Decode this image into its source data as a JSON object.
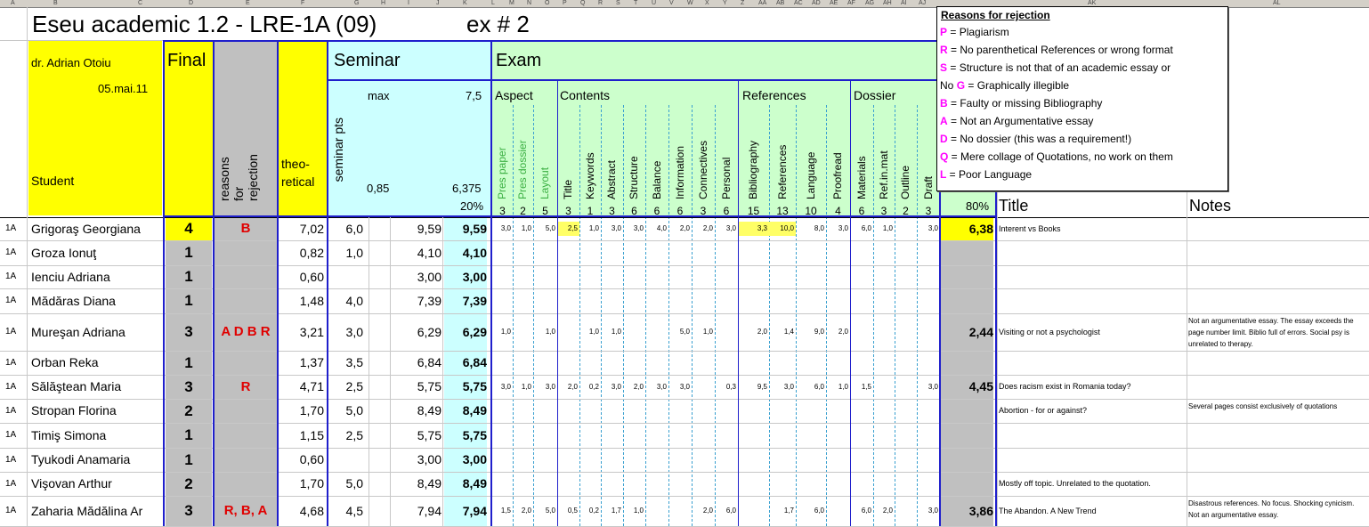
{
  "column_letters": [
    "A",
    "B",
    "C",
    "D",
    "E",
    "F",
    "G",
    "H",
    "I",
    "J",
    "K",
    "L",
    "M",
    "N",
    "O",
    "P",
    "Q",
    "R",
    "S",
    "T",
    "U",
    "V",
    "W",
    "X",
    "Y",
    "Z",
    "AA",
    "AB",
    "AC",
    "AD",
    "AE",
    "AF",
    "AG",
    "AH",
    "AI",
    "AJ",
    "AK",
    "AL"
  ],
  "title": "Eseu academic 1.2 - LRE-1A (09)",
  "exercise": "ex # 2",
  "teacher": "dr. Adrian Otoiu",
  "date": "05.mai.11",
  "student_header": "Student",
  "final_header": "Final",
  "reasons_header": "reasons for rejection",
  "theoretical_header": "theo- retical",
  "seminar_header": "Seminar",
  "seminar_pts_label": "seminar pts",
  "max_label": "max",
  "max_value": "7,5",
  "coef_value": "0,85",
  "seminar_total_max": "6,375",
  "seminar_percent": "20%",
  "exam_header": "Exam",
  "exam_percent": "80%",
  "groups": [
    "Aspect",
    "Contents",
    "References",
    "Dossier"
  ],
  "criteria": [
    {
      "name": "Pres paper",
      "max": "3"
    },
    {
      "name": "Pres dossier",
      "max": "2"
    },
    {
      "name": "Layout",
      "max": "5"
    },
    {
      "name": "Title",
      "max": "3"
    },
    {
      "name": "Keywords",
      "max": "1"
    },
    {
      "name": "Abstract",
      "max": "3"
    },
    {
      "name": "Structure",
      "max": "6"
    },
    {
      "name": "Balance",
      "max": "6"
    },
    {
      "name": "Information",
      "max": "6"
    },
    {
      "name": "Connectives",
      "max": "3"
    },
    {
      "name": "Personal",
      "max": "6"
    },
    {
      "name": "Bibliography",
      "max": "15"
    },
    {
      "name": "References",
      "max": "13"
    },
    {
      "name": "Language",
      "max": "10"
    },
    {
      "name": "Proofread",
      "max": "4"
    },
    {
      "name": "Materials",
      "max": "6"
    },
    {
      "name": "Ref.in.mat",
      "max": "3"
    },
    {
      "name": "Outline",
      "max": "2"
    },
    {
      "name": "Draft",
      "max": "3"
    }
  ],
  "title_col": "Title",
  "notes_col": "Notes",
  "students": [
    {
      "grp": "1A",
      "name": "Grigoraş Georgiana",
      "final": "4",
      "reasons": "B",
      "theo": "7,02",
      "sem": "6,0",
      "semcalc": "9,59",
      "semtot": "9,59",
      "scores": [
        "3,0",
        "1,0",
        "5,0",
        "2,5",
        "1,0",
        "3,0",
        "3,0",
        "4,0",
        "2,0",
        "2,0",
        "3,0",
        "3,3",
        "10,0",
        "8,0",
        "3,0",
        "6,0",
        "1,0",
        "",
        "3,0"
      ],
      "exam": "6,38",
      "title": "Interent vs Books",
      "notes": ""
    },
    {
      "grp": "1A",
      "name": "Groza Ionuţ",
      "final": "1",
      "reasons": "",
      "theo": "0,82",
      "sem": "1,0",
      "semcalc": "4,10",
      "semtot": "4,10",
      "scores": [],
      "exam": "",
      "title": "",
      "notes": ""
    },
    {
      "grp": "1A",
      "name": "Ienciu Adriana",
      "final": "1",
      "reasons": "",
      "theo": "0,60",
      "sem": "",
      "semcalc": "3,00",
      "semtot": "3,00",
      "scores": [],
      "exam": "",
      "title": "",
      "notes": ""
    },
    {
      "grp": "1A",
      "name": "Mădăras Diana",
      "final": "1",
      "reasons": "",
      "theo": "1,48",
      "sem": "4,0",
      "semcalc": "7,39",
      "semtot": "7,39",
      "scores": [],
      "exam": "",
      "title": "",
      "notes": ""
    },
    {
      "grp": "1A",
      "name": "Mureşan Adriana",
      "final": "3",
      "reasons": "A D B R",
      "theo": "3,21",
      "sem": "3,0",
      "semcalc": "6,29",
      "semtot": "6,29",
      "scores": [
        "1,0",
        "",
        "1,0",
        "",
        "1,0",
        "1,0",
        "",
        "",
        "5,0",
        "1,0",
        "",
        "2,0",
        "1,4",
        "9,0",
        "2,0",
        "",
        "",
        "",
        ""
      ],
      "exam": "2,44",
      "title": "Visiting or not a psychologist",
      "notes": "Not an argumentative essay. The essay exceeds the page number limit. Biblio full of errors. Social psy is unrelated to therapy."
    },
    {
      "grp": "1A",
      "name": "Orban Reka",
      "final": "1",
      "reasons": "",
      "theo": "1,37",
      "sem": "3,5",
      "semcalc": "6,84",
      "semtot": "6,84",
      "scores": [],
      "exam": "",
      "title": "",
      "notes": ""
    },
    {
      "grp": "1A",
      "name": "Sălăştean Maria",
      "final": "3",
      "reasons": "R",
      "theo": "4,71",
      "sem": "2,5",
      "semcalc": "5,75",
      "semtot": "5,75",
      "scores": [
        "3,0",
        "1,0",
        "3,0",
        "2,0",
        "0,2",
        "3,0",
        "2,0",
        "3,0",
        "3,0",
        "",
        "0,3",
        "9,5",
        "3,0",
        "6,0",
        "1,0",
        "1,5",
        "",
        "",
        "3,0"
      ],
      "exam": "4,45",
      "title": "Does racism exist in Romania today?",
      "notes": ""
    },
    {
      "grp": "1A",
      "name": "Stropan Florina",
      "final": "2",
      "reasons": "",
      "theo": "1,70",
      "sem": "5,0",
      "semcalc": "8,49",
      "semtot": "8,49",
      "scores": [],
      "exam": "",
      "title": "Abortion - for or against?",
      "notes": "Several pages consist exclusively of quotations"
    },
    {
      "grp": "1A",
      "name": "Timiş Simona",
      "final": "1",
      "reasons": "",
      "theo": "1,15",
      "sem": "2,5",
      "semcalc": "5,75",
      "semtot": "5,75",
      "scores": [],
      "exam": "",
      "title": "",
      "notes": ""
    },
    {
      "grp": "1A",
      "name": "Tyukodi Anamaria",
      "final": "1",
      "reasons": "",
      "theo": "0,60",
      "sem": "",
      "semcalc": "3,00",
      "semtot": "3,00",
      "scores": [],
      "exam": "",
      "title": "",
      "notes": ""
    },
    {
      "grp": "1A",
      "name": "Vişovan Arthur",
      "final": "2",
      "reasons": "",
      "theo": "1,70",
      "sem": "5,0",
      "semcalc": "8,49",
      "semtot": "8,49",
      "scores": [],
      "exam": "",
      "title": "Mostly off topic. Unrelated to the quotation.",
      "notes": ""
    },
    {
      "grp": "1A",
      "name": "Zaharia Mădălina Ar",
      "final": "3",
      "reasons": "R, B, A",
      "theo": "4,68",
      "sem": "4,5",
      "semcalc": "7,94",
      "semtot": "7,94",
      "scores": [
        "1,5",
        "2,0",
        "5,0",
        "0,5",
        "0,2",
        "1,7",
        "1,0",
        "",
        "",
        "2,0",
        "6,0",
        "",
        "1,7",
        "6,0",
        "",
        "6,0",
        "2,0",
        "",
        "3,0"
      ],
      "exam": "3,86",
      "title": "The Abandon. A New Trend",
      "notes": "Disastrous references. No focus. Shocking cynicism. Not an argumentative essay."
    }
  ],
  "popup": {
    "title": "Reasons for rejection",
    "items": [
      {
        "pre": "",
        "key": "P",
        "text": " = Plagiarism"
      },
      {
        "pre": "",
        "key": "R",
        "text": " = No parenthetical References or wrong format"
      },
      {
        "pre": "",
        "key": "S",
        "text": " = Structure is not that of an academic essay or"
      },
      {
        "pre": "No ",
        "key": "G",
        "text": " = Graphically illegible"
      },
      {
        "pre": "",
        "key": "B",
        "text": " = Faulty or missing Bibliography"
      },
      {
        "pre": "",
        "key": "A",
        "text": " = Not an Argumentative essay"
      },
      {
        "pre": "",
        "key": "D",
        "text": " = No dossier (this was a requirement!)"
      },
      {
        "pre": "",
        "key": "Q",
        "text": " = Mere collage of Quotations, no work on them"
      },
      {
        "pre": "",
        "key": "L",
        "text": " = Poor Language"
      }
    ]
  }
}
